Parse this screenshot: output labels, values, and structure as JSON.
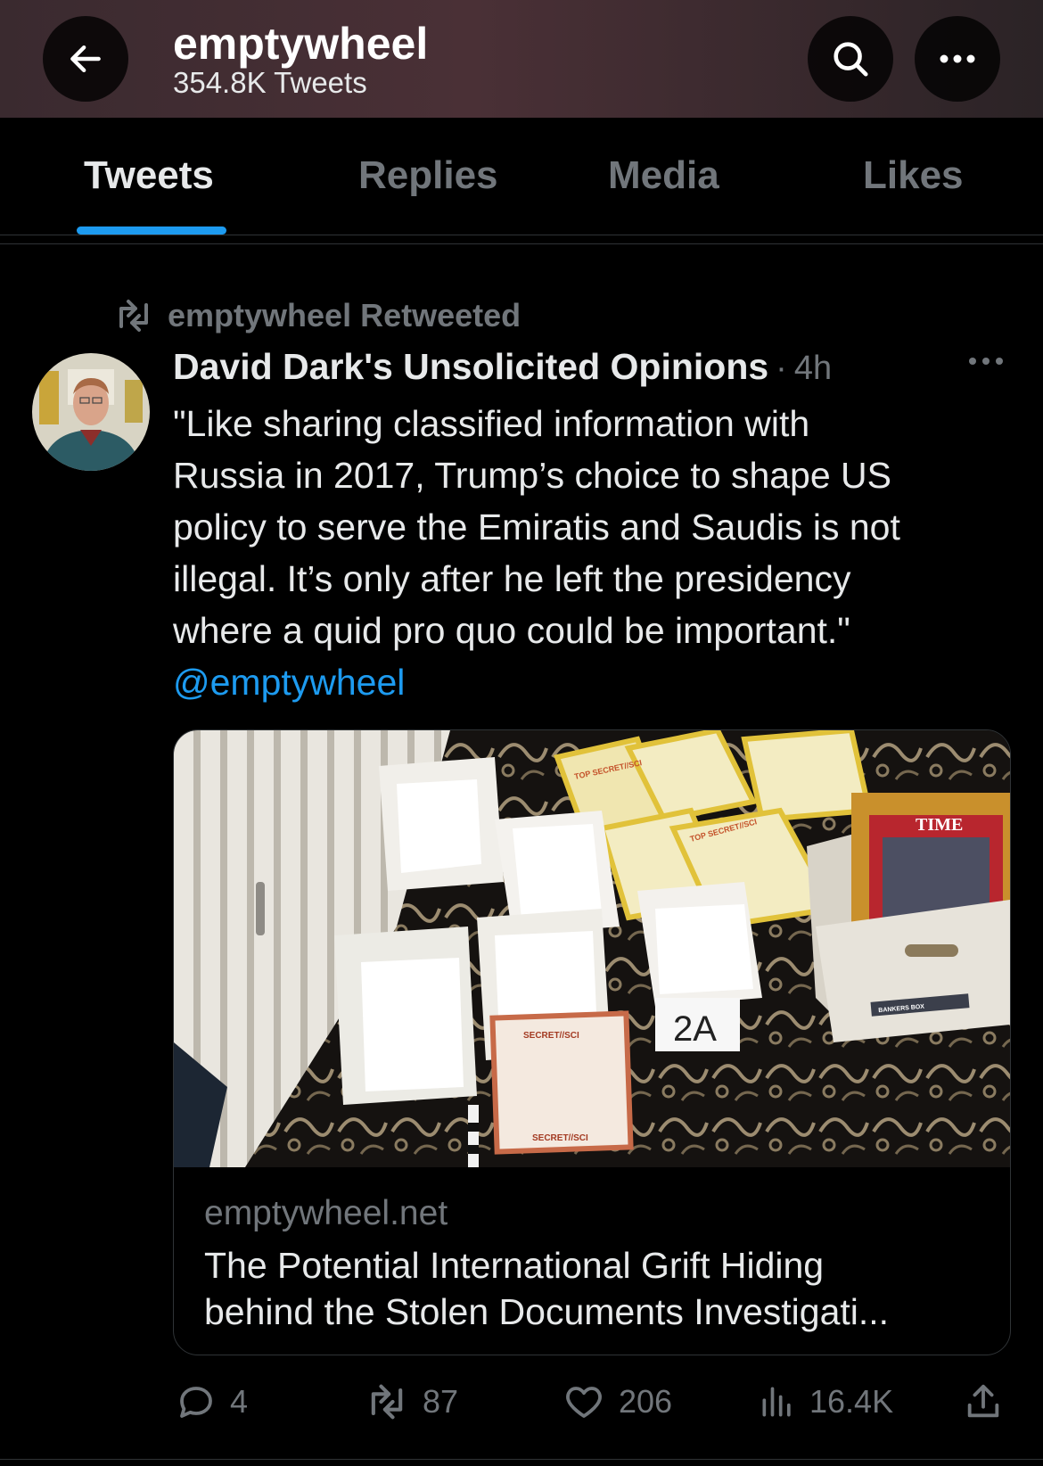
{
  "header": {
    "title": "emptywheel",
    "subtitle": "354.8K Tweets",
    "back_icon": "arrow-left-icon",
    "search_icon": "search-icon",
    "more_icon": "more-horizontal-icon"
  },
  "tabs": [
    {
      "label": "Tweets",
      "active": true
    },
    {
      "label": "Replies",
      "active": false
    },
    {
      "label": "Media",
      "active": false
    },
    {
      "label": "Likes",
      "active": false
    }
  ],
  "tweet": {
    "retweet_label": "emptywheel Retweeted",
    "author": "David Dark's Unsolicited Opinions",
    "separator": "·",
    "time": "4h",
    "text_lines": [
      "\"Like sharing classified information with",
      "Russia in 2017, Trump’s choice to shape US",
      "policy to serve the Emiratis and Saudis is not",
      "illegal. It’s only after he left the presidency",
      "where a quid pro quo could be important.\""
    ],
    "mention": "@emptywheel",
    "card": {
      "domain": "emptywheel.net",
      "title_lines": [
        "The Potential International Grift Hiding",
        "behind the Stolen Documents Investigati..."
      ],
      "image_labels": {
        "cover_top": "TOP SECRET//SCI",
        "cover_secret": "SECRET//SCI",
        "tag": "2A",
        "box_text": "BANKERS BOX",
        "magazine": "TIME"
      }
    },
    "actions": {
      "replies": "4",
      "retweets": "87",
      "likes": "206",
      "views": "16.4K"
    }
  },
  "colors": {
    "accent": "#1d9bf0",
    "muted": "#71767b",
    "text": "#e7e9ea",
    "background": "#000000",
    "header_tint": "#4a3036"
  }
}
